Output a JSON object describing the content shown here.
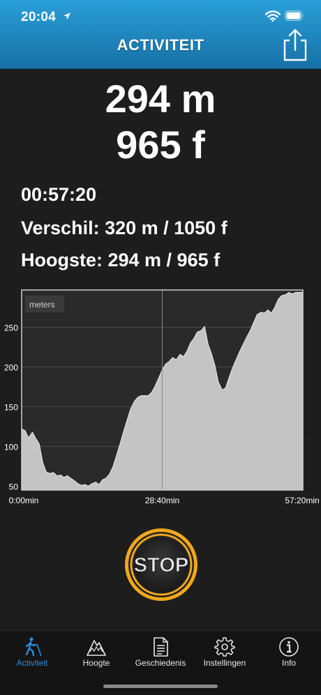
{
  "status_bar": {
    "time": "20:04"
  },
  "header": {
    "title": "ACTIVITEIT"
  },
  "altitude": {
    "meters": "294 m",
    "feet": "965 f"
  },
  "stats": {
    "duration": "00:57:20",
    "difference": "Verschil: 320 m / 1050 f",
    "highest": "Hoogste: 294 m / 965 f"
  },
  "chart_data": {
    "type": "area",
    "legend": "meters",
    "y_ticks": [
      50,
      100,
      150,
      200,
      250
    ],
    "x_tick_labels": [
      "0:00min",
      "28:40min",
      "57:20min"
    ],
    "xlim": [
      0,
      57.33
    ],
    "ylim": [
      45,
      297
    ],
    "grid": true,
    "x": [
      0,
      0.7,
      1.4,
      2.2,
      2.9,
      3.6,
      4.3,
      5.0,
      5.7,
      6.5,
      7.2,
      8.0,
      8.6,
      9.3,
      10.0,
      10.7,
      11.5,
      12.2,
      12.9,
      13.6,
      14.3,
      15.1,
      15.8,
      16.5,
      17.2,
      17.9,
      18.6,
      19.4,
      20.1,
      20.8,
      21.5,
      22.2,
      23.0,
      23.7,
      24.4,
      25.1,
      25.8,
      26.5,
      27.2,
      28.0,
      28.7,
      29.4,
      30.1,
      30.8,
      31.5,
      32.3,
      33.0,
      33.7,
      34.4,
      35.1,
      35.8,
      36.6,
      37.3,
      38.0,
      38.7,
      39.4,
      40.1,
      40.9,
      41.6,
      42.3,
      43.0,
      43.7,
      44.4,
      45.2,
      45.9,
      46.6,
      47.3,
      48.0,
      48.8,
      49.5,
      50.2,
      50.9,
      51.6,
      52.3,
      53.0,
      53.8,
      54.5,
      55.2,
      55.9,
      56.6,
      57.3
    ],
    "values": [
      122,
      120,
      111,
      118,
      110,
      103,
      80,
      68,
      66,
      67,
      63,
      64,
      61,
      63,
      60,
      57,
      53,
      51,
      52,
      50,
      53,
      55,
      52,
      58,
      60,
      65,
      74,
      90,
      104,
      119,
      133,
      147,
      157,
      162,
      164,
      164,
      164,
      168,
      176,
      187,
      197,
      204,
      207,
      212,
      209,
      216,
      213,
      220,
      230,
      236,
      244,
      246,
      251,
      229,
      217,
      202,
      181,
      171,
      174,
      187,
      199,
      209,
      219,
      229,
      238,
      246,
      256,
      266,
      269,
      268,
      272,
      268,
      275,
      285,
      290,
      291,
      294,
      292,
      294,
      294,
      294
    ]
  },
  "stop_button": {
    "label": "STOP"
  },
  "tabs": [
    {
      "label": "Activiteit",
      "icon": "hiker-icon"
    },
    {
      "label": "Hoogte",
      "icon": "mountain-icon"
    },
    {
      "label": "Geschiedenis",
      "icon": "document-icon"
    },
    {
      "label": "Instellingen",
      "icon": "gear-icon"
    },
    {
      "label": "Info",
      "icon": "info-icon"
    }
  ],
  "colors": {
    "header_top": "#2a9fd8",
    "header_bottom": "#1671a6",
    "active_tab": "#2d8fe0",
    "stop_ring": "#f0a81c",
    "chart_fill": "#c4c4c4"
  }
}
